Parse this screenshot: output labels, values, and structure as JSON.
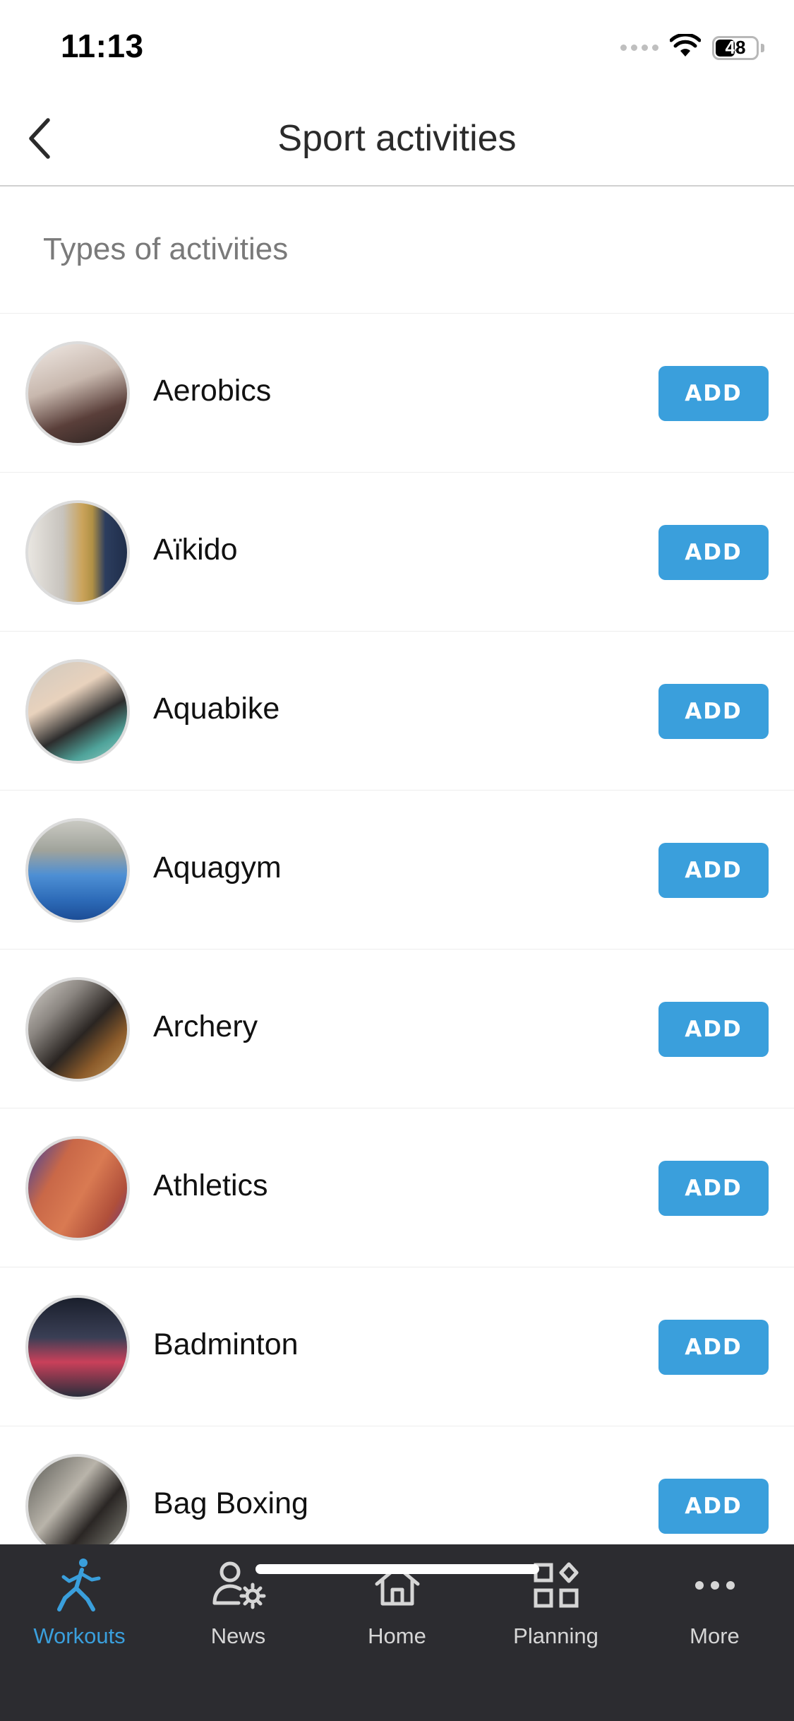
{
  "status_bar": {
    "time": "11:13",
    "battery": "48"
  },
  "header": {
    "title": "Sport activities",
    "back_icon": "chevron-left-icon"
  },
  "section": {
    "title": "Types of activities"
  },
  "activities": [
    {
      "name": "Aerobics",
      "action": "ADD"
    },
    {
      "name": "Aïkido",
      "action": "ADD"
    },
    {
      "name": "Aquabike",
      "action": "ADD"
    },
    {
      "name": "Aquagym",
      "action": "ADD"
    },
    {
      "name": "Archery",
      "action": "ADD"
    },
    {
      "name": "Athletics",
      "action": "ADD"
    },
    {
      "name": "Badminton",
      "action": "ADD"
    },
    {
      "name": "Bag Boxing",
      "action": "ADD"
    }
  ],
  "tab_bar": {
    "items": [
      {
        "label": "Workouts",
        "icon": "runner-icon",
        "active": true
      },
      {
        "label": "News",
        "icon": "people-gear-icon",
        "active": false
      },
      {
        "label": "Home",
        "icon": "home-icon",
        "active": false
      },
      {
        "label": "Planning",
        "icon": "grid-icon",
        "active": false
      },
      {
        "label": "More",
        "icon": "ellipsis-icon",
        "active": false
      }
    ]
  },
  "colors": {
    "accent": "#3a9fdc",
    "tab_bar_bg": "#2c2c30",
    "tab_inactive": "#d6d6d6"
  }
}
